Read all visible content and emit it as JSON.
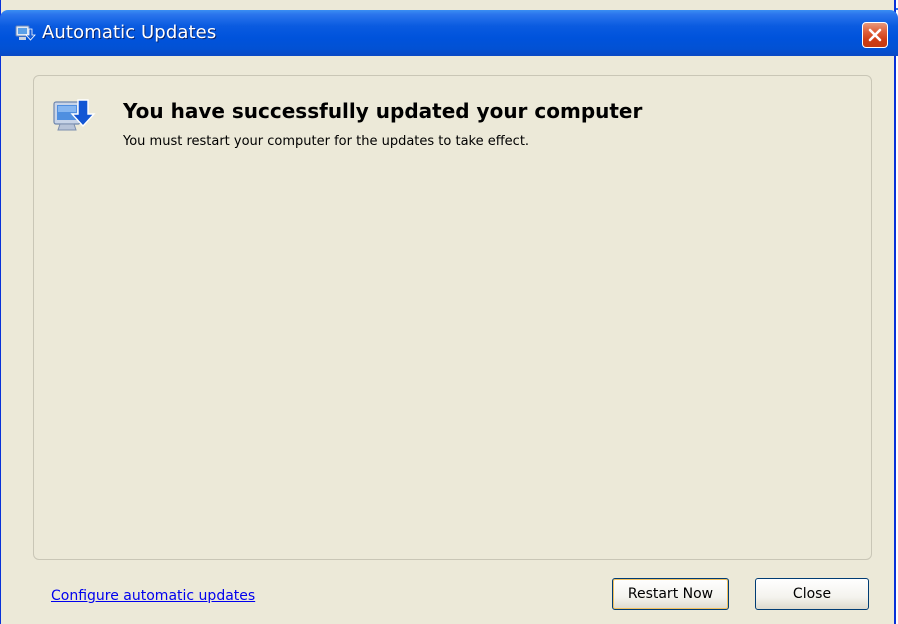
{
  "window": {
    "title": "Automatic Updates"
  },
  "message": {
    "headline": "You have successfully updated your computer",
    "detail": "You must restart your computer for the updates to take effect."
  },
  "footer": {
    "configure_link": "Configure automatic updates",
    "restart_label": "Restart Now",
    "close_label": "Close"
  },
  "icons": {
    "title": "automatic-updates-icon",
    "panel": "computer-update-icon",
    "close": "close-icon"
  },
  "colors": {
    "titlebar": "#0053dc",
    "close_button": "#d8542a",
    "link": "#0000ee",
    "background": "#ece9d8"
  }
}
